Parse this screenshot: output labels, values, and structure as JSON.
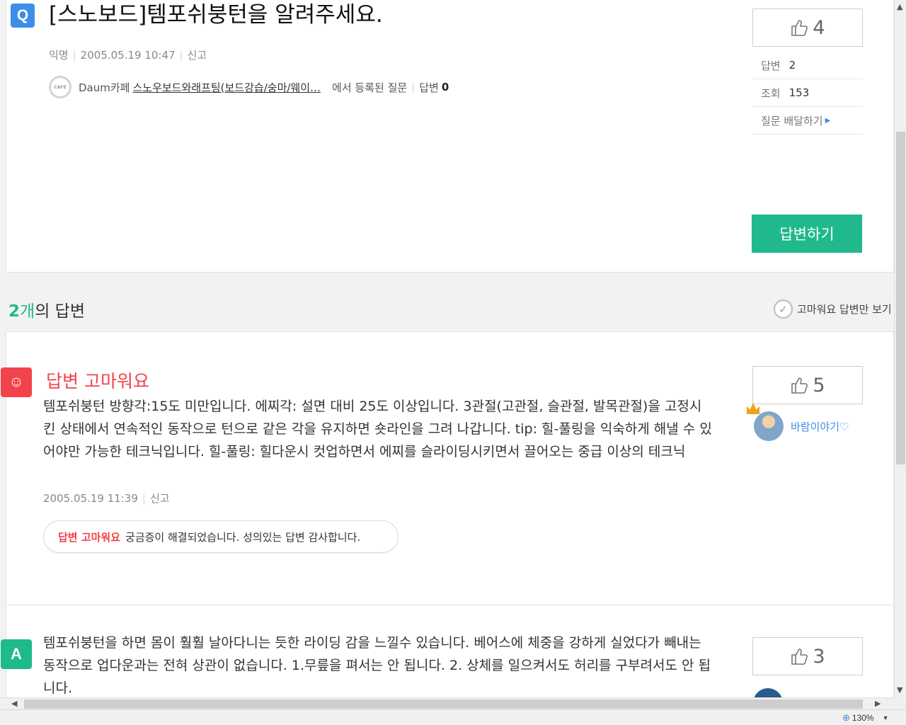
{
  "question": {
    "badge": "Q",
    "title": "[스노보드]템포쉬붕턴을 알려주세요.",
    "author": "익명",
    "date": "2005.05.19 10:47",
    "report": "신고",
    "cafe_icon_text": "CAFE",
    "cafe_prefix": "Daum카페",
    "cafe_name": "스노우보드와래프팅(보드강습/숭마/웨이…",
    "cafe_suffix": "에서 등록된 질문",
    "cafe_answers_label": "답변",
    "cafe_answers_count": "0",
    "likes": "4",
    "stats": {
      "answers_label": "답변",
      "answers_value": "2",
      "views_label": "조회",
      "views_value": "153",
      "deliver_label": "질문 배달하기"
    },
    "answer_button": "답변하기"
  },
  "answers_header": {
    "count": "2",
    "unit": "개",
    "suffix": "의 답변",
    "filter_label": "고마워요 답변만 보기"
  },
  "answers": [
    {
      "badge": "☺",
      "thanks_title": "답변 고마워요",
      "body": "템포쉬붕턴 방향각:15도 미만입니다. 에찌각: 설면 대비 25도 이상입니다. 3관절(고관절, 슬관절, 발목관절)을 고정시킨 상태에서 연속적인 동작으로 턴으로 같은 각을 유지하면 숏라인을 그려 나갑니다. tip: 힐-풀링을 익숙하게 해낼 수 있어야만 가능한 테크닉입니다. 힐-풀링: 힐다운시 컷업하면서 에찌를 슬라이딩시키면서 끌어오는 중급 이상의 테크닉",
      "date": "2005.05.19 11:39",
      "report": "신고",
      "bubble_highlight": "답변 고마워요",
      "bubble_text": "궁금증이 해결되었습니다. 성의있는 답변 감사합니다.",
      "likes": "5",
      "user": "바람이야기♡"
    },
    {
      "badge": "A",
      "body": "템포쉬붕턴을 하면 몸이 훨훨 날아다니는 듯한 라이딩 감을 느낄수 있습니다. 베어스에 체중을 강하게 실었다가 빼내는 동작으로 업다운과는 전혀 상관이 없습니다. 1.무릎을 펴서는 안 됩니다. 2. 상체를 일으켜서도 허리를 구부려서도 안 됩니다.",
      "likes": "3"
    }
  ],
  "status": {
    "zoom": "130%"
  }
}
